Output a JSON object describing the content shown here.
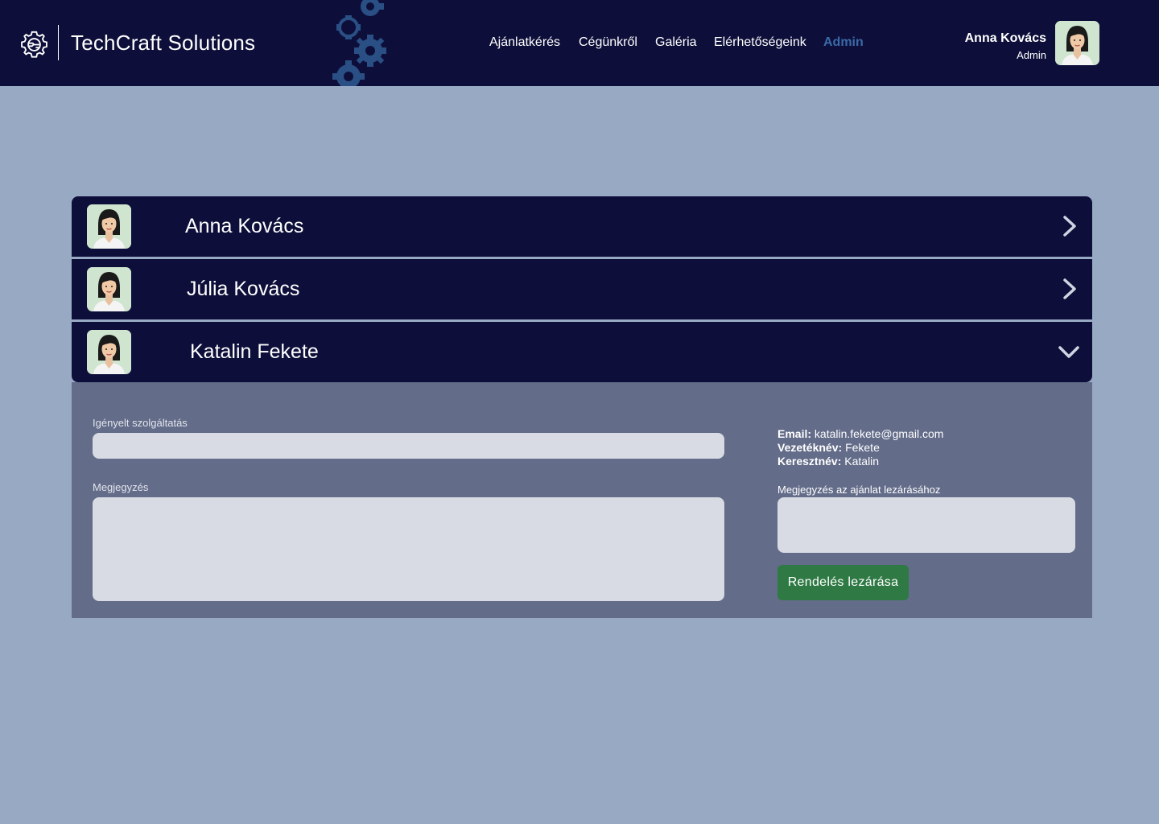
{
  "header": {
    "brand": "TechCraft Solutions",
    "logo_icon": "gear-circuit-icon",
    "decor_icon": "gears-icon",
    "nav": [
      {
        "label": "Ajánlatkérés"
      },
      {
        "label": "Cégünkről"
      },
      {
        "label": "Galéria"
      },
      {
        "label": "Elérhetőségeink"
      },
      {
        "label": "Admin",
        "active": true
      }
    ],
    "user": {
      "name": "Anna Kovács",
      "role": "Admin",
      "avatar_icon": "avatar-icon"
    },
    "bg_color": "#0d0f3a",
    "active_color": "#3a6aa8"
  },
  "accordion": {
    "items": [
      {
        "name": "Anna Kovács",
        "expanded": false,
        "chevron": "chevron-right-icon"
      },
      {
        "name": "Júlia Kovács",
        "expanded": false,
        "chevron": "chevron-right-icon"
      },
      {
        "name": "Katalin Fekete",
        "expanded": true,
        "chevron": "chevron-down-icon"
      }
    ]
  },
  "detail": {
    "service_label": "Igényelt szolgáltatás",
    "service_value": "",
    "note_label": "Megjegyzés",
    "note_value": "",
    "email_label": "Email:",
    "email_value": "katalin.fekete@gmail.com",
    "lastname_label": "Vezetéknév:",
    "lastname_value": "Fekete",
    "firstname_label": "Keresztnév:",
    "firstname_value": "Katalin",
    "close_note_label": "Megjegyzés az ajánlat lezárásához",
    "close_note_value": "",
    "close_button": "Rendelés lezárása",
    "button_color": "#2f7a44",
    "panel_color": "#636c89"
  },
  "page": {
    "bg_color": "#98a9c3"
  }
}
